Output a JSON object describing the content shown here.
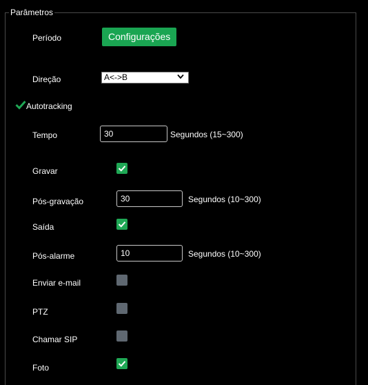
{
  "panel": {
    "title": "Parâmetros"
  },
  "fields": {
    "periodo": {
      "label": "Período",
      "button": "Configurações"
    },
    "direcao": {
      "label": "Direção",
      "value": "A<->B"
    },
    "autotracking": {
      "label": "Autotracking",
      "checked": true
    },
    "tempo": {
      "label": "Tempo",
      "value": "30",
      "unit": "Segundos (15~300)"
    },
    "gravar": {
      "label": "Gravar",
      "checked": true
    },
    "pos_gravacao": {
      "label": "Pós-gravação",
      "value": "30",
      "unit": "Segundos (10~300)"
    },
    "saida": {
      "label": "Saída",
      "checked": true
    },
    "pos_alarme": {
      "label": "Pós-alarme",
      "value": "10",
      "unit": "Segundos (10~300)"
    },
    "enviar_email": {
      "label": "Enviar e-mail",
      "checked": false
    },
    "ptz": {
      "label": "PTZ",
      "checked": false
    },
    "chamar_sip": {
      "label": "Chamar SIP",
      "checked": false
    },
    "foto": {
      "label": "Foto",
      "checked": true
    }
  },
  "colors": {
    "accent": "#1aa552",
    "checkbox_off": "#5f6871",
    "background": "#000000"
  }
}
